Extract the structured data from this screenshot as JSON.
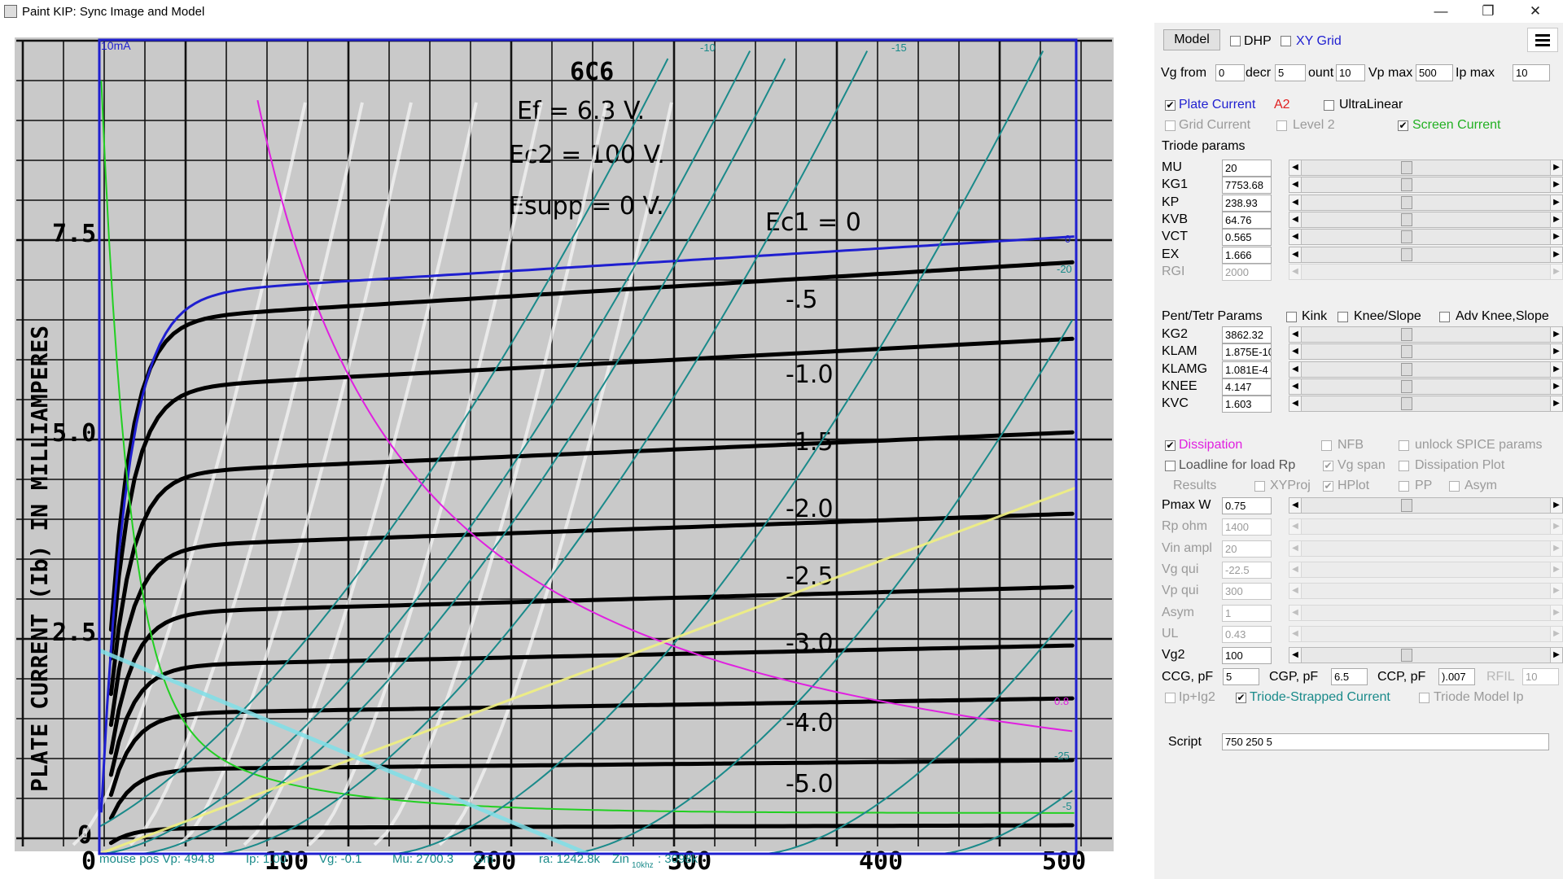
{
  "window": {
    "title": "Paint KIP: Sync Image and Model",
    "min": "—",
    "max": "❐",
    "close": "✕"
  },
  "plot": {
    "image_title": "6C6",
    "image_text": [
      "Ef = 6.3 V.",
      "Ec2 = 100 V.",
      "Esupp = 0 V.",
      "Ec1 = 0"
    ],
    "grid_labels": [
      "-.5",
      "-1.0",
      "-1.5",
      "-2.0",
      "-2.5",
      "-3.0",
      "-4.0",
      "-5.0"
    ],
    "y_ticks": [
      "7.5",
      "5.0",
      "2.5",
      "0"
    ],
    "x_ticks": [
      "0",
      "100",
      "200",
      "300",
      "400",
      "500"
    ],
    "y_axis_label": "PLATE CURRENT (Ib) IN MILLIAMPERES",
    "top_left": "10mA",
    "top_labels": [
      "-10",
      "-15"
    ],
    "right_labels": [
      "0",
      "-20",
      "-25",
      "-5"
    ],
    "pmax_label": "0.8",
    "status": {
      "mouse_pos": "mouse pos Vp: 494.8",
      "ip": "Ip: 1.00",
      "vg": "Vg: -0.1",
      "mu": "Mu: 2700.3",
      "gm": "Gm",
      "ra": "ra: 1242.8k",
      "zin": "Zin",
      "zin_sub": "10khz",
      "zin_val": ": 3098k"
    },
    "colors": {
      "plate": "#1f1fd0",
      "screen": "#22d022",
      "pdis": "#e020e0",
      "teal": "#1a8a8a",
      "load": "#f0f080",
      "aux": "#80e0e8"
    }
  },
  "panel": {
    "model_button": "Model",
    "dhp": "DHP",
    "xy_grid": "XY Grid",
    "vg_from_label": "Vg from",
    "vg_from": "0",
    "decr_label": "decr",
    "decr": "5",
    "count_label": "ount",
    "count": "10",
    "vpmax_label": "Vp max",
    "vpmax": "500",
    "ipmax_label": "Ip max",
    "ipmax": "10",
    "plate_current": "Plate Current",
    "a2": "A2",
    "ultralinear": "UltraLinear",
    "grid_current": "Grid Current",
    "level2": "Level 2",
    "screen_current": "Screen Current",
    "triode_params": "Triode params",
    "triode": [
      {
        "name": "MU",
        "value": "20"
      },
      {
        "name": "KG1",
        "value": "7753.68"
      },
      {
        "name": "KP",
        "value": "238.93"
      },
      {
        "name": "KVB",
        "value": "64.76"
      },
      {
        "name": "VCT",
        "value": "0.565"
      },
      {
        "name": "EX",
        "value": "1.666"
      },
      {
        "name": "RGI",
        "value": "2000"
      }
    ],
    "pent_params": "Pent/Tetr Params",
    "kink": "Kink",
    "knee_slope": "Knee/Slope",
    "adv_knee": "Adv Knee,Slope",
    "pent": [
      {
        "name": "KG2",
        "value": "3862.32"
      },
      {
        "name": "KLAM",
        "value": "1.875E-10"
      },
      {
        "name": "KLAMG",
        "value": "1.081E-4"
      },
      {
        "name": "KNEE",
        "value": "4.147"
      },
      {
        "name": "KVC",
        "value": "1.603"
      }
    ],
    "dissipation": "Dissipation",
    "nfb": "NFB",
    "unlock_spice": "unlock SPICE params",
    "loadline": "Loadline for load Rp",
    "vg_span": "Vg span",
    "dissipation_plot": "Dissipation Plot",
    "results": "Results",
    "xyproj": "XYProj",
    "hplot": "HPlot",
    "pp": "PP",
    "asym_cb": "Asym",
    "loadparams": [
      {
        "name": "Pmax W",
        "value": "0.75"
      },
      {
        "name": "Rp ohm",
        "value": "1400"
      },
      {
        "name": "Vin ampl",
        "value": "20"
      },
      {
        "name": "Vg qui",
        "value": "-22.5"
      },
      {
        "name": "Vp qui",
        "value": "300"
      },
      {
        "name": "Asym",
        "value": "1"
      },
      {
        "name": "UL",
        "value": "0.43"
      },
      {
        "name": "Vg2",
        "value": "100"
      }
    ],
    "ccg_label": "CCG, pF",
    "ccg": "5",
    "cgp_label": "CGP, pF",
    "cgp": "6.5",
    "ccp_label": "CCP, pF",
    "ccp": ").007",
    "rfil_label": "RFIL",
    "rfil": "10",
    "ip_ig2": "Ip+Ig2",
    "triode_strapped": "Triode-Strapped Current",
    "triode_model_ip": "Triode Model Ip",
    "script_label": "Script",
    "script_value": "750 250 5"
  }
}
